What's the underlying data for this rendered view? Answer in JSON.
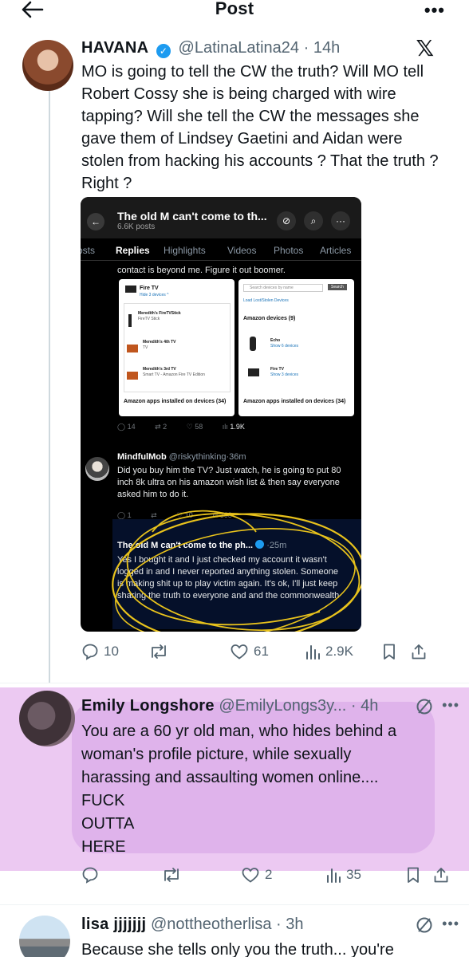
{
  "header": {
    "title": "Post",
    "back_icon": "arrow-left-icon",
    "more": "•••"
  },
  "post": {
    "display_name": "HAVANA",
    "handle": "@LatinaLatina24",
    "time": "14h",
    "text": "MO is going to tell the CW the truth?  Will MO tell Robert Cossy she is being charged with wire tapping? Will she tell the CW the messages she gave them of Lindsey Gaetini and Aidan were stolen from hacking his accounts ? That the truth ? Right ?",
    "replies": "10",
    "reposts": "",
    "likes": "61",
    "views": "2.9K"
  },
  "embed": {
    "title": "The old M can't come to th...",
    "subtitle": "6.6K posts",
    "tabs": [
      "osts",
      "Replies",
      "Highlights",
      "Videos",
      "Photos",
      "Articles"
    ],
    "top_line": "contact is beyond me. Figure it out boomer.",
    "left_card": {
      "header": "Fire TV",
      "sub": "Hide 3 devices ^",
      "items": [
        {
          "name": "Meredith's FireTVStick",
          "detail": "FireTV Stick"
        },
        {
          "name": "Meredith's 4th TV",
          "detail": "TV"
        },
        {
          "name": "Meredith's 3rd TV",
          "detail": "Smart TV - Amazon Fire TV Edition"
        }
      ],
      "footer": "Amazon apps installed on devices (34)"
    },
    "right_card": {
      "search": "Search devices by name",
      "search_btn": "Search",
      "link": "Load Lost/Stolen Devices",
      "section": "Amazon devices (9)",
      "items": [
        {
          "name": "Echo",
          "detail": "Show 6 devices"
        },
        {
          "name": "Fire TV",
          "detail": "Show 3 devices"
        }
      ],
      "footer": "Amazon apps installed on devices (34)"
    },
    "metrics1": {
      "replies": "14",
      "reposts": "2",
      "likes": "58",
      "views": "1.9K"
    },
    "reply1": {
      "name": "MindfulMob",
      "handle": "@riskythinking",
      "time": "36m",
      "text": "Did you buy him the TV? Just watch, he is going to put  80 inch 8k ultra on his amazon wish list & then say everyone asked him to do it."
    },
    "metrics2": {
      "replies": "1",
      "likes": "10",
      "views": "363"
    },
    "reply2": {
      "name": "The old M can't come to the ph...",
      "time": "25m",
      "text": "Yes I bought it and I just checked my account it wasn't logged in and I never reported anything stolen. Someone is making shit up to play victim again. It's ok, I'll just keep sharing the truth to everyone and and the commonwealth"
    }
  },
  "reply_emily": {
    "display_name": "Emily Longshore",
    "handle": "@EmilyLongs3y...",
    "time": "4h",
    "text_lines": [
      "You are a 60 yr old man, who hides behind a",
      "woman's profile picture, while sexually",
      "harassing and assaulting women online....",
      "FUCK",
      "OUTTA",
      "HERE"
    ],
    "replies": "",
    "reposts": "",
    "likes": "2",
    "views": "35"
  },
  "reply_lisa": {
    "display_name": "lisa jjjjjjj",
    "handle": "@nottheotherlisa",
    "time": "3h",
    "text": "Because she tells only you the truth... you're"
  },
  "colors": {
    "accent": "#1d9bf0",
    "muted": "#536471",
    "highlight": "#ecc9f2",
    "scribble": "#e8c21c"
  }
}
